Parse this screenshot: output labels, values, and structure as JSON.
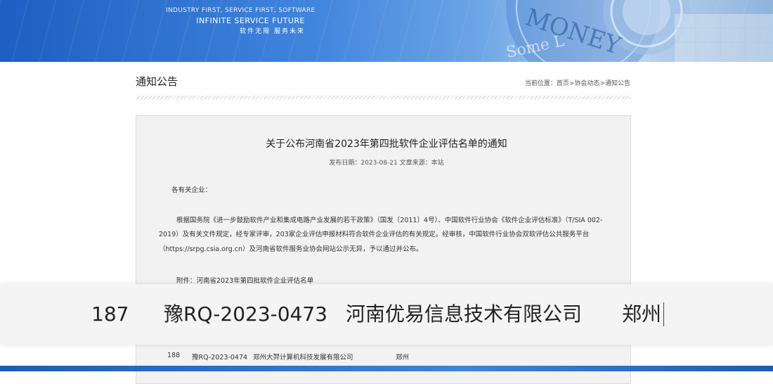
{
  "banner": {
    "slogan_line1": "INDUSTRY FIRST, SERVICE FIRST, SOFTWARE",
    "slogan_line2": "INFINITE SERVICE FUTURE",
    "slogan_line3": "软件无限    服务未来",
    "deco_text1": "MONEY",
    "deco_text2": "Some L"
  },
  "section": {
    "title": "通知公告",
    "breadcrumb": "当前位置：首页>协会动态>通知公告"
  },
  "article": {
    "title": "关于公布河南省2023年第四批软件企业评估名单的通知",
    "meta": "发布日期：2023-08-21 文章来源：本站",
    "salutation": "各有关企业：",
    "body_line1": "根据国务院《进一步鼓励软件产业和集成电路产业发展的若干政策》（国发〔2011〕4号）、中国软件行业协会《软件企业评估标准》（T/SIA 002-",
    "body_line2": "2019）及有关文件规定，经专家评审，203家企业评估申报材料符合软件企业评估的有关规定。经审核，中国软件行业协会双软评估公共服务平台",
    "body_line3": "（https://srpg.csia.org.cn）及河南省软件服务业协会网站公示无异，予以通过并公布。",
    "attachment": "附件：河南省2023年第四批软件企业评估名单"
  },
  "rows": [
    {
      "no": "187",
      "code": "豫RQ-2023-0473",
      "company": "河南优易信息技术有限公司",
      "city": "郑州"
    },
    {
      "no": "188",
      "code": "豫RQ-2023-0474",
      "company": "郑州大羿计算机科技发展有限公司",
      "city": "郑州"
    }
  ]
}
